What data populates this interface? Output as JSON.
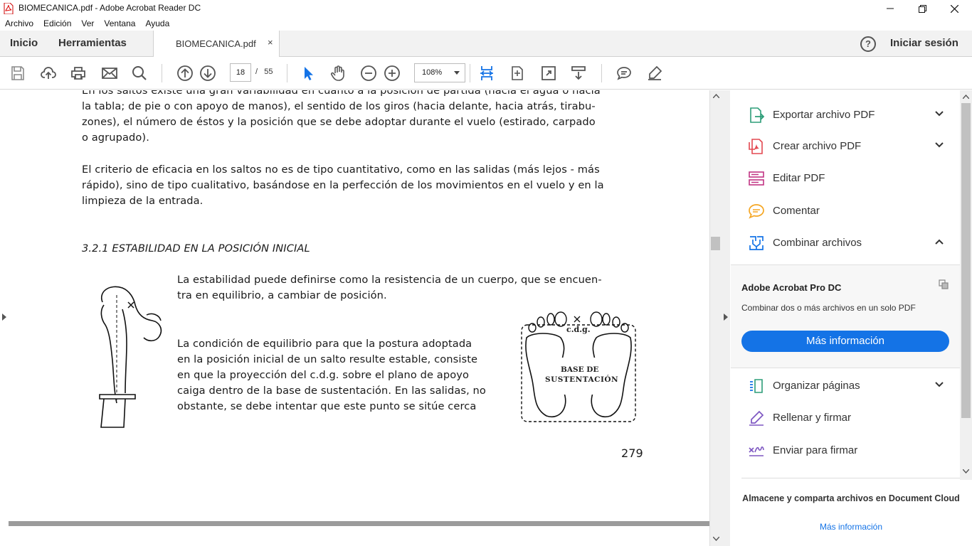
{
  "window": {
    "title": "BIOMECANICA.pdf - Adobe Acrobat Reader DC"
  },
  "menu": [
    "Archivo",
    "Edición",
    "Ver",
    "Ventana",
    "Ayuda"
  ],
  "tabs": {
    "home": "Inicio",
    "tools": "Herramientas",
    "document": "BIOMECANICA.pdf",
    "close_glyph": "×",
    "help_glyph": "?",
    "signin": "Iniciar sesión"
  },
  "toolbar": {
    "page_current": "18",
    "page_sep": "/",
    "page_total": "55",
    "zoom": "108%",
    "icons": [
      "save-icon",
      "upload-icon",
      "print-icon",
      "email-icon",
      "search-icon",
      "prev-page-icon",
      "next-page-icon",
      "select-cursor-icon",
      "hand-icon",
      "zoom-out-icon",
      "zoom-in-icon",
      "fit-page-icon",
      "rotate-icon",
      "fullscreen-icon",
      "scroll-mode-icon",
      "comment-icon",
      "highlight-icon"
    ]
  },
  "document": {
    "para1": [
      "En los saltos existe una gran variabilidad en cuanto a la posición de partida (hacia el agua o hacia",
      "la tabla; de pie o con apoyo de manos), el sentido de los giros (hacia delante, hacia atrás, tirabu-",
      "zones), el número de éstos y la posición que se debe adoptar durante el vuelo (estirado, carpado",
      "o agrupado)."
    ],
    "para2": [
      "El criterio de eficacia en los saltos no es de tipo cuantitativo, como en las salidas (más lejos - más",
      "rápido), sino de tipo cualitativo, basándose en la perfección de los movimientos en el vuelo y en la",
      "limpieza de la entrada."
    ],
    "heading": "3.2.1  ESTABILIDAD EN LA POSICIÓN INICIAL",
    "para3": [
      "La estabilidad puede definirse como la resistencia de un cuerpo, que se encuen-",
      "tra en equilibrio, a cambiar de posición."
    ],
    "para4": [
      "La condición de equilibrio para que la postura adoptada",
      "en la posición inicial de un salto resulte estable, consiste",
      "en que la proyección del c.d.g. sobre el plano de apoyo",
      "caiga dentro de la base de sustentación. En las salidas, no",
      "obstante, se debe intentar que este punto se sitúe cerca"
    ],
    "figure": {
      "cdg_label": "c.d.g.",
      "base_line1": "BASE DE",
      "base_line2": "SUSTENTACIÓN"
    },
    "page_number": "279"
  },
  "right_pane": {
    "tools_top": [
      {
        "label": "Exportar archivo PDF",
        "icon": "export-pdf-icon",
        "chevron": "down",
        "color": "#2d9d78"
      },
      {
        "label": "Crear archivo PDF",
        "icon": "create-pdf-icon",
        "chevron": "down",
        "color": "#e34850"
      },
      {
        "label": "Editar PDF",
        "icon": "edit-pdf-icon",
        "chevron": "",
        "color": "#c13584"
      },
      {
        "label": "Comentar",
        "icon": "comment-bubble-icon",
        "chevron": "",
        "color": "#f5a623"
      },
      {
        "label": "Combinar archivos",
        "icon": "combine-files-icon",
        "chevron": "up",
        "color": "#1473e6"
      }
    ],
    "promo": {
      "title": "Adobe Acrobat Pro DC",
      "desc": "Combinar dos o más archivos en un solo PDF",
      "button": "Más información"
    },
    "tools_bottom": [
      {
        "label": "Organizar páginas",
        "icon": "organize-pages-icon",
        "chevron": "down",
        "color": "#2d9d78"
      },
      {
        "label": "Rellenar y firmar",
        "icon": "fill-sign-icon",
        "chevron": "",
        "color": "#7e57c2"
      },
      {
        "label": "Enviar para firmar",
        "icon": "send-sign-icon",
        "chevron": "",
        "color": "#7e57c2"
      }
    ],
    "cloud_text": "Almacene y comparta archivos en Document Cloud",
    "cloud_link": "Más información"
  },
  "colors": {
    "accent": "#1473e6",
    "select_tool": "#1473e6"
  }
}
